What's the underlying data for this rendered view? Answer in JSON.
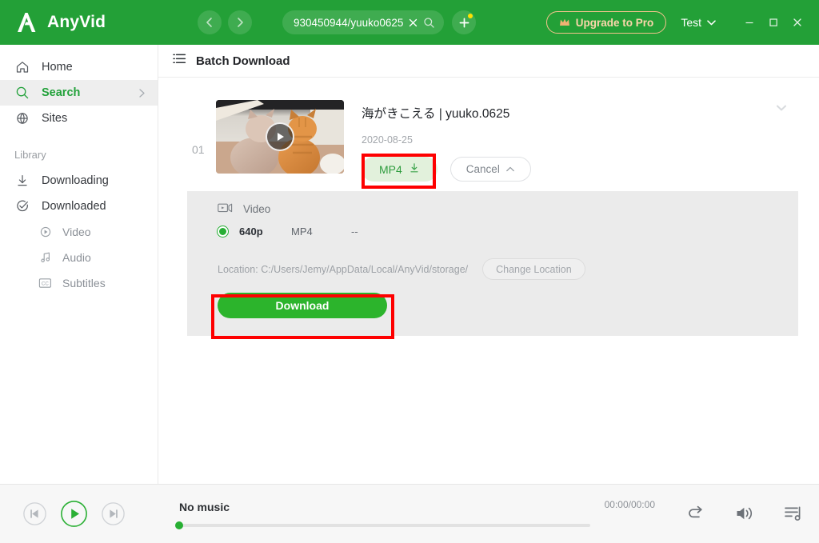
{
  "titlebar": {
    "brand": "AnyVid",
    "search": {
      "value": "930450944/yuuko0625",
      "clear_icon": "close-icon",
      "search_icon": "search-icon"
    },
    "add_tab_label": "+",
    "upgrade_label": "Upgrade to Pro",
    "account_label": "Test",
    "window": {
      "minimize": "minimize-icon",
      "maximize": "maximize-icon",
      "close": "close-icon"
    },
    "accent_green": "#23a037",
    "upgrade_color": "#fbd6ab"
  },
  "sidebar": {
    "items": [
      {
        "label": "Home",
        "icon": "home-icon",
        "active": false
      },
      {
        "label": "Search",
        "icon": "search-icon",
        "active": true
      },
      {
        "label": "Sites",
        "icon": "globe-icon",
        "active": false
      }
    ],
    "section_label": "Library",
    "library_items": [
      {
        "label": "Downloading",
        "icon": "download-icon"
      },
      {
        "label": "Downloaded",
        "icon": "check-circle-icon"
      }
    ],
    "sub_items": [
      {
        "label": "Video",
        "icon": "play-circle-icon"
      },
      {
        "label": "Audio",
        "icon": "music-note-icon"
      },
      {
        "label": "Subtitles",
        "icon": "cc-icon"
      }
    ]
  },
  "page": {
    "title": "Batch Download",
    "title_icon": "list-icon"
  },
  "item": {
    "index": "01",
    "title": "海がきこえる | yuuko.0625",
    "date": "2020-08-25",
    "format_button": "MP4",
    "format_button_icon": "download-icon",
    "cancel_button": "Cancel",
    "cancel_icon": "chevron-up-icon",
    "collapse_icon": "chevron-down-icon",
    "thumbnail_alt": "two cats sitting by a window"
  },
  "expanded": {
    "stream_type": "Video",
    "stream_icon": "video-icon",
    "format_rows": [
      {
        "quality": "640p",
        "container": "MP4",
        "size": "--",
        "selected": true
      }
    ],
    "location_label": "Location: C:/Users/Jemy/AppData/Local/AnyVid/storage/",
    "change_location_label": "Change Location",
    "download_label": "Download"
  },
  "player": {
    "prev_icon": "skip-previous-icon",
    "play_icon": "play-icon",
    "next_icon": "skip-next-icon",
    "track_title": "No music",
    "time": "00:00/00:00",
    "repeat_icon": "repeat-icon",
    "volume_icon": "volume-icon",
    "playlist_icon": "playlist-icon",
    "progress_percent": 0
  },
  "annotations": {
    "highlight_color": "#fe0000",
    "boxes": [
      {
        "name": "mp4-button-highlight"
      },
      {
        "name": "download-button-highlight"
      }
    ]
  }
}
